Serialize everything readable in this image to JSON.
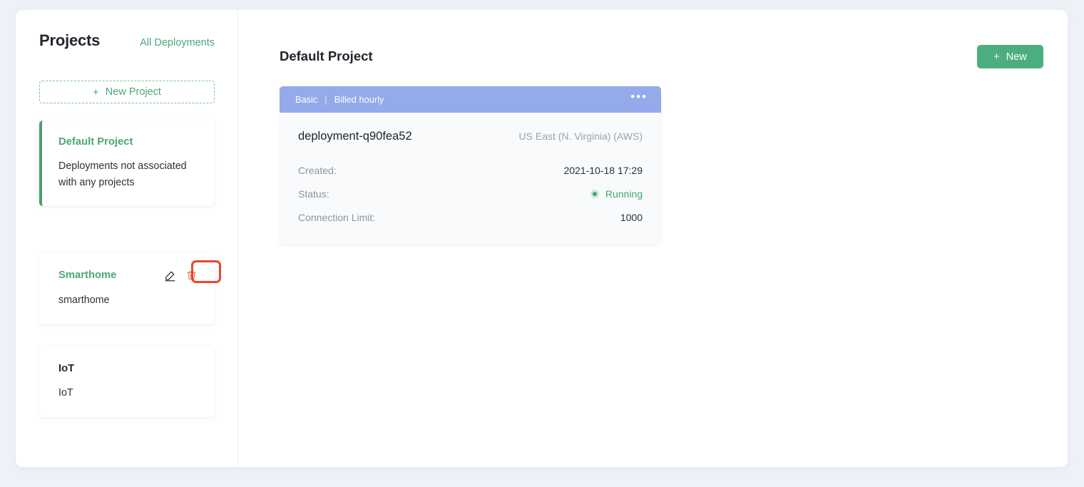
{
  "sidebar": {
    "title": "Projects",
    "all_deployments_label": "All Deployments",
    "new_project_label": "New Project",
    "new_project_plus": "+",
    "projects": [
      {
        "name": "Default Project",
        "description": "Deployments not associated with any projects",
        "active": true,
        "has_actions": false
      },
      {
        "name": "Smarthome",
        "description": "smarthome",
        "active": false,
        "has_actions": true,
        "edit_icon": "pencil-icon",
        "delete_icon": "trash-icon"
      },
      {
        "name": "IoT",
        "description": "IoT",
        "active": false,
        "has_actions": false
      }
    ]
  },
  "main": {
    "title": "Default Project",
    "new_button_label": "New",
    "new_button_plus": "+",
    "deployment": {
      "plan": "Basic",
      "separator": "|",
      "billing": "Billed hourly",
      "menu_icon": "•••",
      "name": "deployment-q90fea52",
      "region": "US East (N. Virginia) (AWS)",
      "rows": [
        {
          "label": "Created:",
          "value": "2021-10-18 17:29"
        },
        {
          "label": "Status:",
          "value": "Running",
          "status": true
        },
        {
          "label": "Connection Limit:",
          "value": "1000"
        }
      ]
    }
  },
  "colors": {
    "accent_green": "#4cae7f",
    "header_blue": "#94aaea",
    "highlight_red": "#e8472a",
    "status_green": "#41a972",
    "page_background": "#eef2f8"
  }
}
